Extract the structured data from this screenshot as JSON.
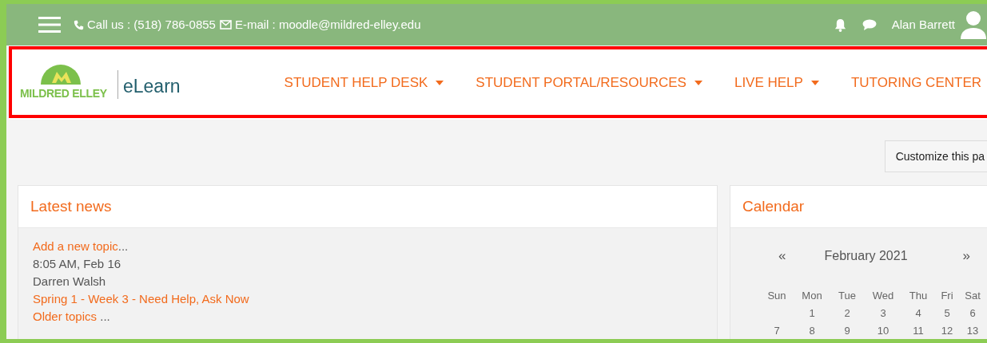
{
  "top_bar": {
    "phone": "Call us : (518) 786-0855",
    "email": "E-mail : moodle@mildred-elley.edu",
    "user_name": "Alan Barrett"
  },
  "header": {
    "logo_text": "MILDRED ELLEY",
    "site_name": "eLearn",
    "highlighted": true,
    "nav": [
      {
        "label": "STUDENT HELP DESK",
        "has_menu": true
      },
      {
        "label": "STUDENT PORTAL/RESOURCES",
        "has_menu": true
      },
      {
        "label": "LIVE HELP",
        "has_menu": true
      },
      {
        "label": "TUTORING CENTER",
        "has_menu": false
      }
    ]
  },
  "customize_button": "Customize this pa",
  "latest_news": {
    "title": "Latest news",
    "lines": [
      {
        "kind": "link",
        "text": "Add a new topic",
        "suffix": "..."
      },
      {
        "kind": "plain",
        "text": "8:05 AM, Feb 16"
      },
      {
        "kind": "plain",
        "text": "Darren Walsh"
      },
      {
        "kind": "link",
        "text": "Spring 1 - Week 3 - Need Help, Ask Now"
      },
      {
        "kind": "link",
        "text": "Older topics",
        "suffix": " ..."
      }
    ]
  },
  "calendar": {
    "title": "Calendar",
    "prev": "«",
    "month": "February 2021",
    "next": "»",
    "weekdays": [
      "Sun",
      "Mon",
      "Tue",
      "Wed",
      "Thu",
      "Fri",
      "Sat"
    ],
    "weeks": [
      {
        "days": [
          "1",
          "2",
          "3",
          "4",
          "5",
          "6"
        ]
      },
      {
        "days": [
          "7",
          "8",
          "9",
          "10",
          "11",
          "12",
          "13"
        ]
      }
    ]
  }
}
